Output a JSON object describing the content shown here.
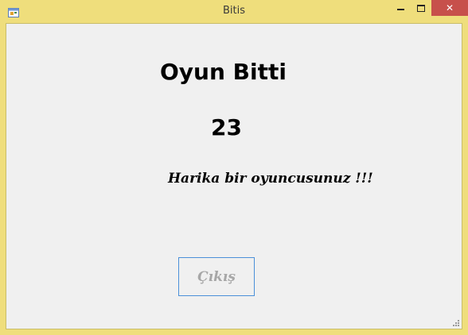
{
  "window": {
    "title": "Bitis",
    "controls": {
      "minimize": "minimize-icon",
      "maximize": "maximize-icon",
      "close_label": "✕"
    },
    "icon": "app-form-icon"
  },
  "content": {
    "heading": "Oyun Bitti",
    "score": "23",
    "message": "Harika bir oyuncusunuz !!!",
    "exit_button_label": "Çıkış"
  },
  "colors": {
    "title_bar": "#efde7c",
    "close_button": "#c7504b",
    "client_background": "#f0f0f0",
    "button_border": "#4a90d9",
    "disabled_text": "#a7a7a7"
  }
}
